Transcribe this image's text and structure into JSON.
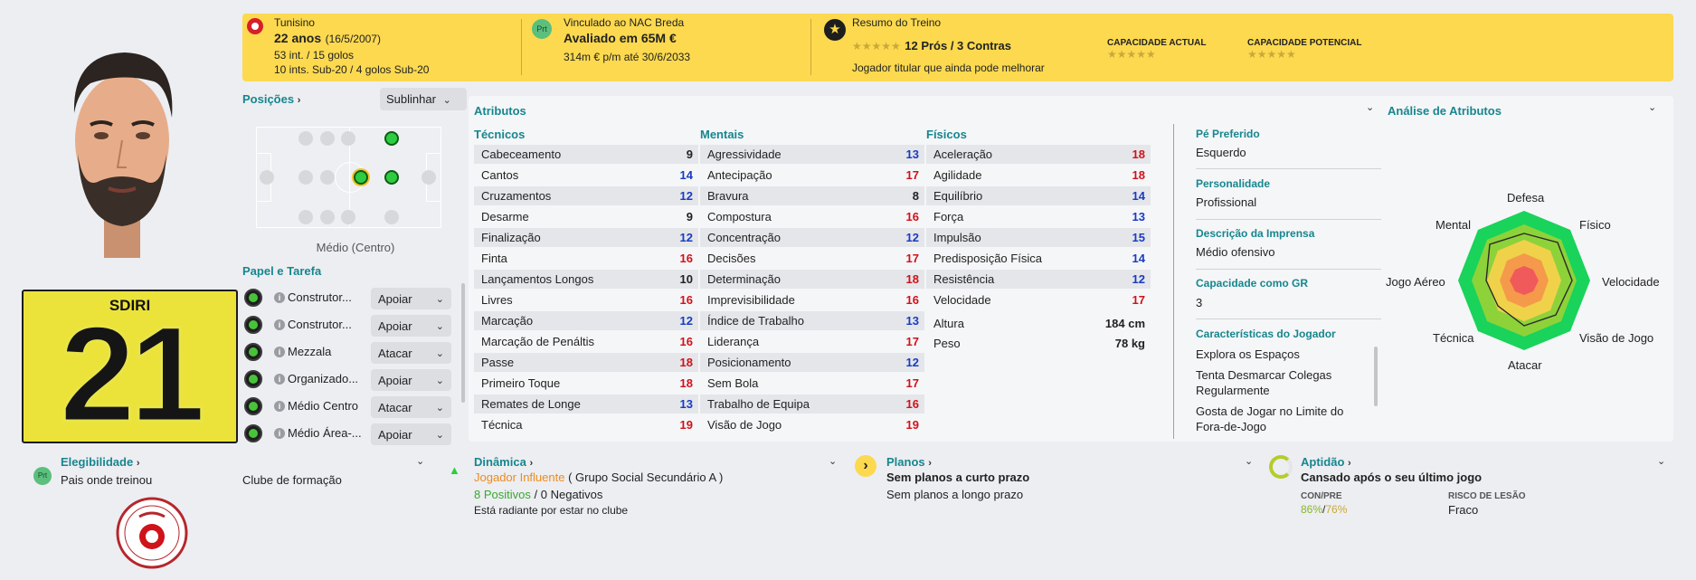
{
  "header": {
    "nationality": "Tunisino",
    "age": "22 anos",
    "dob": "(16/5/2007)",
    "caps": "53 int. / 15 golos",
    "youth_caps": "10 ints. Sub-20 / 4 golos Sub-20",
    "contract_label": "Vinculado ao NAC Breda",
    "value": "Avaliado em 65M €",
    "wage": "314m € p/m até 30/6/2033",
    "training_label": "Resumo do Treino",
    "pros_cons": "12 Prós / 3 Contras",
    "training_note": "Jogador titular que ainda pode melhorar",
    "ca_label": "CAPACIDADE ACTUAL",
    "pa_label": "CAPACIDADE POTENCIAL",
    "ca_stars": "★★★★★",
    "pa_stars": "★★★★★",
    "summary_stars": "★★★★★",
    "prt_badge": "Prt"
  },
  "left": {
    "shirt_name": "SDIRI",
    "shirt_number": "21",
    "eligibility_label": "Elegibilidade",
    "eligibility_value": "Pais onde treinou",
    "prt_badge": "Prt"
  },
  "positions": {
    "label": "Posições",
    "sublinhar": "Sublinhar",
    "position_name": "Médio (Centro)",
    "roles_label": "Papel e Tarefa",
    "roles": [
      {
        "name": "Construtor...",
        "duty": "Apoiar"
      },
      {
        "name": "Construtor...",
        "duty": "Apoiar"
      },
      {
        "name": "Mezzala",
        "duty": "Atacar"
      },
      {
        "name": "Organizado...",
        "duty": "Apoiar"
      },
      {
        "name": "Médio Centro",
        "duty": "Atacar"
      },
      {
        "name": "Médio Área-...",
        "duty": "Apoiar"
      }
    ],
    "club_label": "Clube de formação"
  },
  "attributes": {
    "title": "Atributos",
    "technical_label": "Técnicos",
    "mental_label": "Mentais",
    "physical_label": "Físicos",
    "technical": [
      {
        "name": "Cabeceamento",
        "value": "9",
        "color": "#222222"
      },
      {
        "name": "Cantos",
        "value": "14",
        "color": "#1a3bc1"
      },
      {
        "name": "Cruzamentos",
        "value": "12",
        "color": "#1a3bc1"
      },
      {
        "name": "Desarme",
        "value": "9",
        "color": "#222222"
      },
      {
        "name": "Finalização",
        "value": "12",
        "color": "#1a3bc1"
      },
      {
        "name": "Finta",
        "value": "16",
        "color": "#d0121a"
      },
      {
        "name": "Lançamentos Longos",
        "value": "10",
        "color": "#222222"
      },
      {
        "name": "Livres",
        "value": "16",
        "color": "#d0121a"
      },
      {
        "name": "Marcação",
        "value": "12",
        "color": "#1a3bc1"
      },
      {
        "name": "Marcação de Penáltis",
        "value": "16",
        "color": "#d0121a"
      },
      {
        "name": "Passe",
        "value": "18",
        "color": "#d0121a"
      },
      {
        "name": "Primeiro Toque",
        "value": "18",
        "color": "#d0121a"
      },
      {
        "name": "Remates de Longe",
        "value": "13",
        "color": "#1a3bc1"
      },
      {
        "name": "Técnica",
        "value": "19",
        "color": "#d0121a"
      }
    ],
    "mental": [
      {
        "name": "Agressividade",
        "value": "13",
        "color": "#1a3bc1"
      },
      {
        "name": "Antecipação",
        "value": "17",
        "color": "#d0121a"
      },
      {
        "name": "Bravura",
        "value": "8",
        "color": "#222222"
      },
      {
        "name": "Compostura",
        "value": "16",
        "color": "#d0121a"
      },
      {
        "name": "Concentração",
        "value": "12",
        "color": "#1a3bc1"
      },
      {
        "name": "Decisões",
        "value": "17",
        "color": "#d0121a"
      },
      {
        "name": "Determinação",
        "value": "18",
        "color": "#d0121a"
      },
      {
        "name": "Imprevisibilidade",
        "value": "16",
        "color": "#d0121a"
      },
      {
        "name": "Índice de Trabalho",
        "value": "13",
        "color": "#1a3bc1"
      },
      {
        "name": "Liderança",
        "value": "17",
        "color": "#d0121a"
      },
      {
        "name": "Posicionamento",
        "value": "12",
        "color": "#1a3bc1"
      },
      {
        "name": "Sem Bola",
        "value": "17",
        "color": "#d0121a"
      },
      {
        "name": "Trabalho de Equipa",
        "value": "16",
        "color": "#d0121a"
      },
      {
        "name": "Visão de Jogo",
        "value": "19",
        "color": "#d0121a"
      }
    ],
    "physical": [
      {
        "name": "Aceleração",
        "value": "18",
        "color": "#d0121a"
      },
      {
        "name": "Agilidade",
        "value": "18",
        "color": "#d0121a"
      },
      {
        "name": "Equilíbrio",
        "value": "14",
        "color": "#1a3bc1"
      },
      {
        "name": "Força",
        "value": "13",
        "color": "#1a3bc1"
      },
      {
        "name": "Impulsão",
        "value": "15",
        "color": "#1a3bc1"
      },
      {
        "name": "Predisposição Física",
        "value": "14",
        "color": "#1a3bc1"
      },
      {
        "name": "Resistência",
        "value": "12",
        "color": "#1a3bc1"
      },
      {
        "name": "Velocidade",
        "value": "17",
        "color": "#d0121a"
      }
    ],
    "height_label": "Altura",
    "height_value": "184 cm",
    "weight_label": "Peso",
    "weight_value": "78 kg"
  },
  "info": {
    "foot_label": "Pé Preferido",
    "foot_value": "Esquerdo",
    "personality_label": "Personalidade",
    "personality_value": "Profissional",
    "media_label": "Descrição da Imprensa",
    "media_value": "Médio ofensivo",
    "gk_label": "Capacidade como GR",
    "gk_value": "3",
    "traits_label": "Características do Jogador",
    "traits": [
      "Explora os Espaços",
      "Tenta Desmarcar Colegas Regularmente",
      "Gosta de Jogar no Limite do Fora-de-Jogo"
    ]
  },
  "analysis": {
    "title": "Análise de Atributos",
    "labels": [
      "Defesa",
      "Físico",
      "Velocidade",
      "Visão de Jogo",
      "Atacar",
      "Técnica",
      "Jogo Aéreo",
      "Mental"
    ]
  },
  "bottom": {
    "dynamics_label": "Dinâmica",
    "influencer": "Jogador Influente",
    "social_group": "( Grupo Social Secundário A )",
    "positives": "8 Positivos",
    "slash": "/",
    "negatives": "0 Negativos",
    "dynamics_note": "Está radiante por estar no clube",
    "plans_label": "Planos",
    "plans_short": "Sem planos a curto prazo",
    "plans_long": "Sem planos a longo prazo",
    "fitness_label": "Aptidão",
    "fitness_status": "Cansado após o seu último jogo",
    "conpre_label": "CON/PRE",
    "conpre_con": "86%",
    "conpre_slash": "/",
    "conpre_pre": "76%",
    "injury_label": "RISCO DE LESÃO",
    "injury_value": "Fraco"
  }
}
